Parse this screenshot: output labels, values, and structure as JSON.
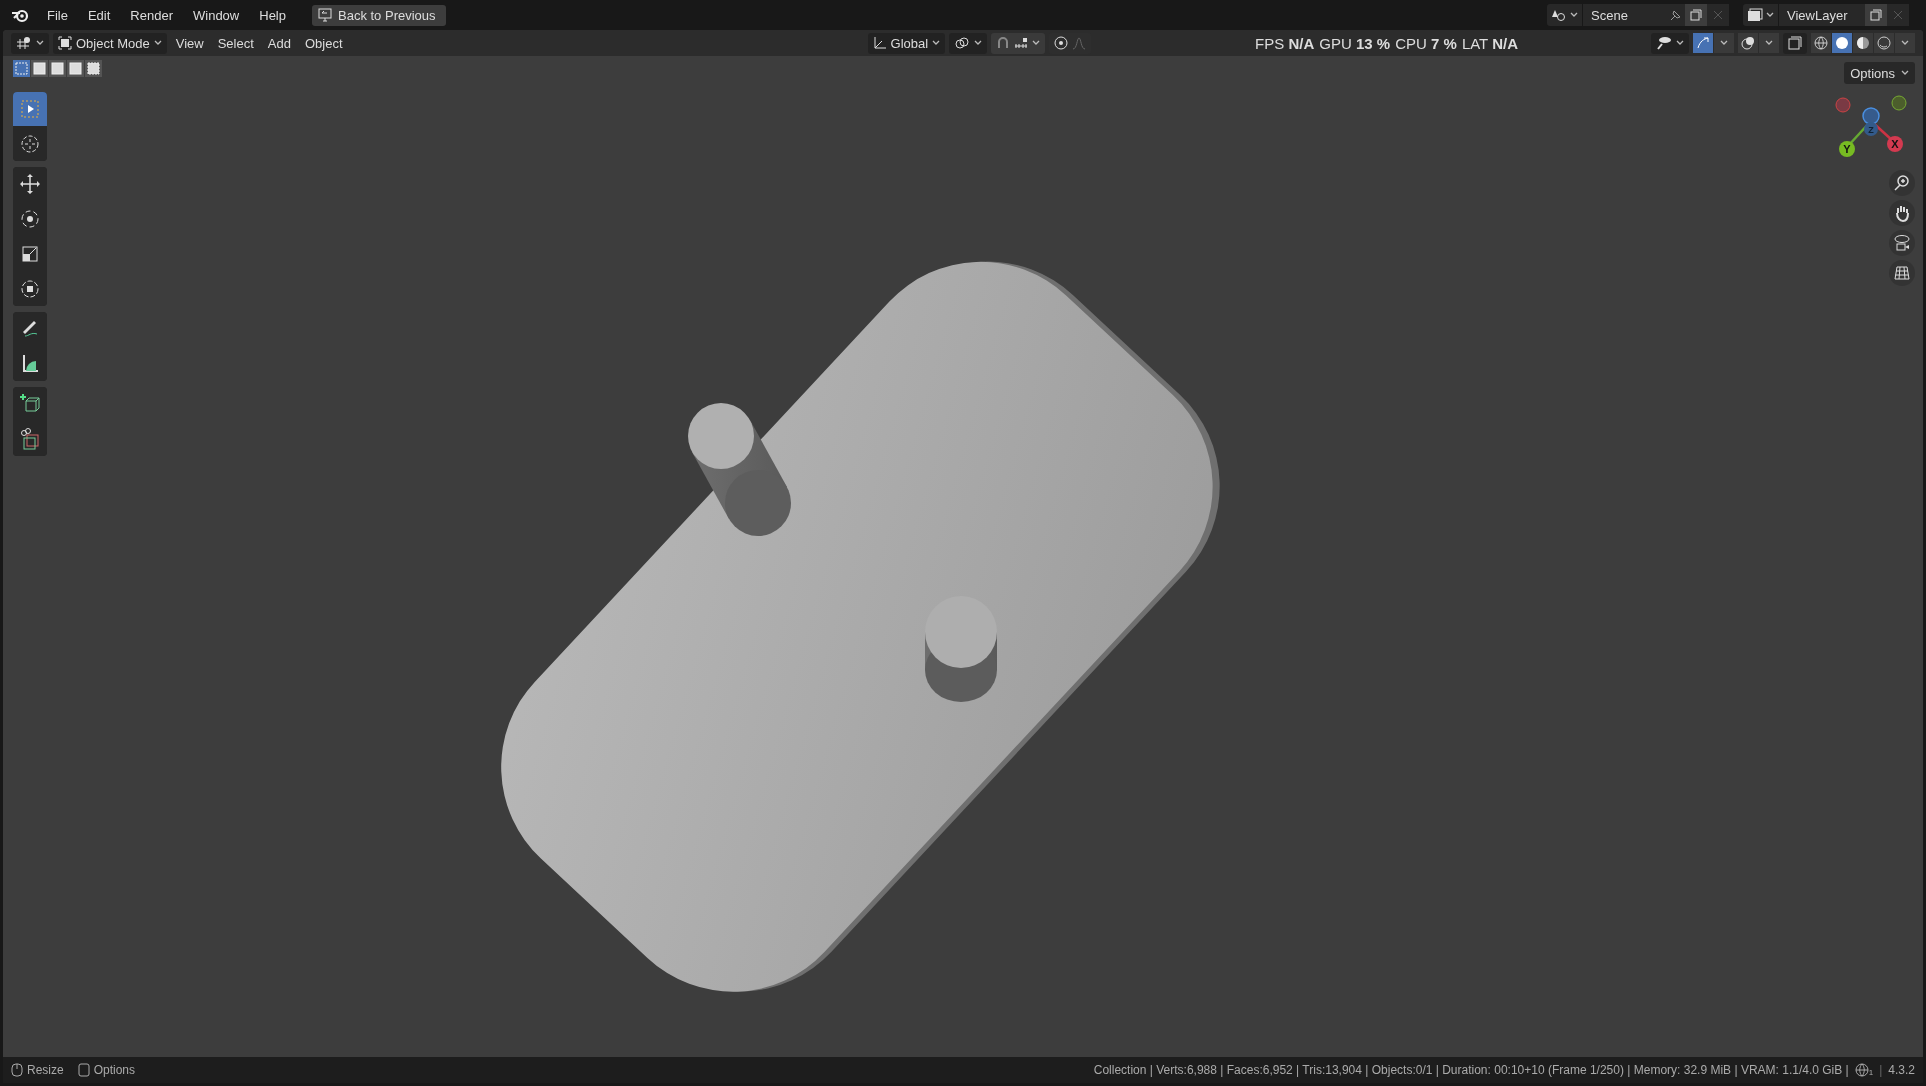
{
  "menu_bar": {
    "items": [
      "File",
      "Edit",
      "Render",
      "Window",
      "Help"
    ],
    "back_button": "Back to Previous"
  },
  "scene": {
    "label": "Scene"
  },
  "view_layer": {
    "label": "ViewLayer"
  },
  "header": {
    "mode": "Object Mode",
    "menus": [
      "View",
      "Select",
      "Add",
      "Object"
    ],
    "orientation": "Global",
    "stats": [
      {
        "label": "FPS",
        "value": "N/A"
      },
      {
        "label": "GPU",
        "value": "13 %"
      },
      {
        "label": "CPU",
        "value": "7 %"
      },
      {
        "label": "LAT",
        "value": "N/A"
      }
    ],
    "gizmos_on": true,
    "snap_on": false,
    "proportional_on": false,
    "shading_modes": [
      {
        "kind": "wireframe",
        "selected": false
      },
      {
        "kind": "solid",
        "selected": true
      },
      {
        "kind": "material",
        "selected": false
      },
      {
        "kind": "rendered",
        "selected": false
      }
    ],
    "options": "Options"
  },
  "select_modes": [
    {
      "selected": true
    },
    {
      "selected": false
    },
    {
      "selected": false
    },
    {
      "selected": false
    },
    {
      "selected": false
    }
  ],
  "tools": [
    {
      "kind": "select",
      "selected": true
    },
    {
      "kind": "cursor",
      "selected": false
    },
    {
      "kind": "move",
      "selected": false
    },
    {
      "kind": "rotate",
      "selected": false
    },
    {
      "kind": "scale",
      "selected": false
    },
    {
      "kind": "transform",
      "selected": false
    },
    {
      "kind": "annotate",
      "selected": false
    },
    {
      "kind": "measure",
      "selected": false
    },
    {
      "kind": "add-cube",
      "selected": false
    },
    {
      "kind": "cut",
      "selected": false
    }
  ],
  "axes": [
    {
      "label": "X"
    },
    {
      "label": "Y"
    },
    {
      "label": "Z"
    }
  ],
  "status_bar": {
    "hints": [
      {
        "kind": "mouse",
        "label": "Resize"
      },
      {
        "kind": "key",
        "label": "Options"
      }
    ],
    "stats": "Collection | Verts:6,988 | Faces:6,952 | Tris:13,904 | Objects:0/1 | Duration: 00:10+10 (Frame 1/250) | Memory: 32.9 MiB | VRAM: 1.1/4.0 GiB |",
    "network_count": "1",
    "separator": "|",
    "version": "4.3.2"
  }
}
